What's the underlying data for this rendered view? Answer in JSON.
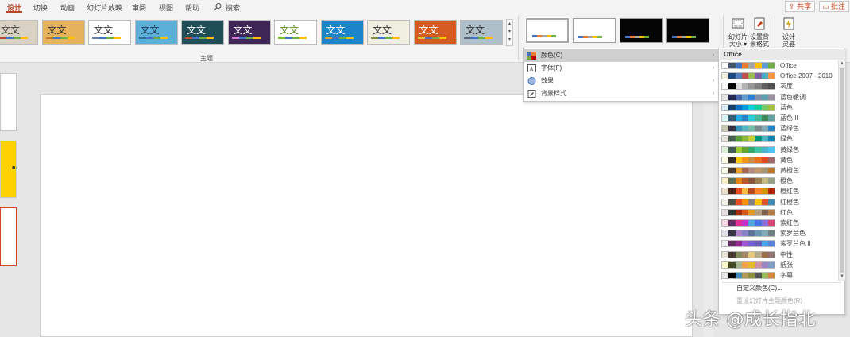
{
  "tabs": [
    {
      "label": "设计",
      "active": true
    },
    {
      "label": "切换",
      "active": false
    },
    {
      "label": "动画",
      "active": false
    },
    {
      "label": "幻灯片放映",
      "active": false
    },
    {
      "label": "审阅",
      "active": false
    },
    {
      "label": "视图",
      "active": false
    },
    {
      "label": "帮助",
      "active": false
    }
  ],
  "search_label": "搜索",
  "share_label": "共享",
  "comments_label": "批注",
  "themes_group_label": "主题",
  "theme_thumbnails": [
    {
      "text": "文文",
      "bg": "#d9d1c4",
      "fg": "#444444",
      "bar": "#b04a3a"
    },
    {
      "text": "文文",
      "bg": "#e7b35a",
      "fg": "#333333",
      "bar": "#c07a2f"
    },
    {
      "text": "文文",
      "bg": "#ffffff",
      "fg": "#333333",
      "bar": "#6b7fa6"
    },
    {
      "text": "文文",
      "bg": "#5ab0d8",
      "fg": "#1f3b57",
      "bar": "#2d6e96"
    },
    {
      "text": "文文",
      "bg": "#1f4e57",
      "fg": "#ffffff",
      "bar": "#d04a3c"
    },
    {
      "text": "文文",
      "bg": "#3e2657",
      "fg": "#ffffff",
      "bar": "#d17ad2"
    },
    {
      "text": "文文",
      "bg": "#ffffff",
      "fg": "#5a8a1f",
      "bar": "#7fbe31"
    },
    {
      "text": "文文",
      "bg": "#1a86c9",
      "fg": "#ffffff",
      "bar": "#e3a32a"
    },
    {
      "text": "文文",
      "bg": "#efeee0",
      "fg": "#333333",
      "bar": "#7e8c48"
    },
    {
      "text": "文文",
      "bg": "#d45a20",
      "fg": "#ffffff",
      "bar": "#f0c040"
    },
    {
      "text": "文文",
      "bg": "#aebfca",
      "fg": "#333333",
      "bar": "#576a7a"
    }
  ],
  "variants": [
    {
      "bg": "#ffffff",
      "selected": true
    },
    {
      "bg": "#ffffff",
      "selected": false
    },
    {
      "bg": "#050505",
      "selected": false
    },
    {
      "bg": "#050505",
      "selected": false
    }
  ],
  "ribbon_buttons": [
    {
      "label": "幻灯片\n大小",
      "icon": "slide-size-icon"
    },
    {
      "label": "设置背\n景格式",
      "icon": "format-background-icon"
    },
    {
      "label": "设计\n灵感",
      "icon": "design-ideas-icon"
    }
  ],
  "menu": {
    "items": [
      {
        "label": "颜色(C)",
        "icon": "colors-icon",
        "highlighted": true
      },
      {
        "label": "字体(F)",
        "icon": "fonts-icon",
        "highlighted": false
      },
      {
        "label": "效果",
        "icon": "effects-icon",
        "highlighted": false
      },
      {
        "label": "背景样式",
        "icon": "background-styles-icon",
        "highlighted": false
      }
    ]
  },
  "colors_submenu": {
    "header": "Office",
    "schemes": [
      {
        "name": "Office",
        "colors": [
          "#ffffff",
          "#44546a",
          "#4472c4",
          "#ed7d31",
          "#a5a5a5",
          "#ffc000",
          "#5b9bd5",
          "#70ad47"
        ]
      },
      {
        "name": "Office 2007 - 2010",
        "colors": [
          "#eeece1",
          "#1f497d",
          "#4f81bd",
          "#c0504d",
          "#9bbb59",
          "#8064a2",
          "#4bacc6",
          "#f79646"
        ]
      },
      {
        "name": "灰度",
        "colors": [
          "#f8f8f8",
          "#000000",
          "#dddddd",
          "#b2b2b2",
          "#969696",
          "#808080",
          "#5f5f5f",
          "#4d4d4d"
        ]
      },
      {
        "name": "蓝色暖调",
        "colors": [
          "#e7e6e6",
          "#242852",
          "#4a66ac",
          "#629dd1",
          "#297fd5",
          "#7f8fa9",
          "#5aa2ae",
          "#9d90a0"
        ]
      },
      {
        "name": "蓝色",
        "colors": [
          "#dbeff9",
          "#17406d",
          "#0f6fc6",
          "#009dd9",
          "#0bd0d9",
          "#10cf9b",
          "#7cca62",
          "#a5c249"
        ]
      },
      {
        "name": "蓝色 II",
        "colors": [
          "#dbf5f9",
          "#335b74",
          "#1cade4",
          "#2683c6",
          "#27ced7",
          "#42ba97",
          "#3e8853",
          "#62a39f"
        ]
      },
      {
        "name": "蓝绿色",
        "colors": [
          "#c8c8b1",
          "#373545",
          "#3494ba",
          "#58b6c0",
          "#75bda7",
          "#7a8c8e",
          "#84acb6",
          "#2683c6"
        ]
      },
      {
        "name": "绿色",
        "colors": [
          "#e9e5dc",
          "#455f51",
          "#549e39",
          "#8ab833",
          "#c0cf3a",
          "#029676",
          "#4ab5c4",
          "#0989b1"
        ]
      },
      {
        "name": "黄绿色",
        "colors": [
          "#dbefd7",
          "#455f51",
          "#99cb38",
          "#63a537",
          "#37a76f",
          "#44c1a3",
          "#4eb3cf",
          "#51c3f9"
        ]
      },
      {
        "name": "黄色",
        "colors": [
          "#fffde6",
          "#39302a",
          "#ffca08",
          "#f8931d",
          "#ce8d3e",
          "#ec7016",
          "#e64823",
          "#9c6a6a"
        ]
      },
      {
        "name": "黄橙色",
        "colors": [
          "#fcf8e8",
          "#4e3b30",
          "#f0a22e",
          "#a5644e",
          "#b58b80",
          "#c3986d",
          "#a19574",
          "#c17529"
        ]
      },
      {
        "name": "橙色",
        "colors": [
          "#fbeec9",
          "#637052",
          "#e48312",
          "#bd582c",
          "#865640",
          "#9b8357",
          "#c2bc80",
          "#94a088"
        ]
      },
      {
        "name": "橙红色",
        "colors": [
          "#e7dec9",
          "#4f271c",
          "#e84c22",
          "#ffbd47",
          "#b64926",
          "#ff8427",
          "#cc9900",
          "#b22600"
        ]
      },
      {
        "name": "红橙色",
        "colors": [
          "#f2efe5",
          "#505046",
          "#e84c22",
          "#f69200",
          "#838383",
          "#fec306",
          "#df5327",
          "#418ab3"
        ]
      },
      {
        "name": "红色",
        "colors": [
          "#e7dfe0",
          "#323232",
          "#a5300f",
          "#d55816",
          "#e19825",
          "#b19c7d",
          "#7f5f52",
          "#b27d49"
        ]
      },
      {
        "name": "紫红色",
        "colors": [
          "#f6d4e2",
          "#632e62",
          "#e32d91",
          "#c830cc",
          "#4ea6dc",
          "#4775e7",
          "#8971e1",
          "#d54773"
        ]
      },
      {
        "name": "紫罗兰色",
        "colors": [
          "#e3e0ea",
          "#373545",
          "#ad84c6",
          "#8784c7",
          "#5d739a",
          "#6997af",
          "#84acb6",
          "#6f8183"
        ]
      },
      {
        "name": "紫罗兰色 II",
        "colors": [
          "#f0eef3",
          "#632e62",
          "#92278f",
          "#9b57d3",
          "#755dd9",
          "#665eb8",
          "#45a5ed",
          "#5982db"
        ]
      },
      {
        "name": "中性",
        "colors": [
          "#e8e2d7",
          "#4a3c31",
          "#7f8b5b",
          "#a08661",
          "#e6c77e",
          "#b6a98c",
          "#9b6e4b",
          "#90746d"
        ]
      },
      {
        "name": "纸张",
        "colors": [
          "#fefac9",
          "#444d26",
          "#a5b592",
          "#f3a447",
          "#e7bc29",
          "#d092a7",
          "#9c85c0",
          "#809ec2"
        ]
      },
      {
        "name": "字幕",
        "colors": [
          "#e8e8e8",
          "#000000",
          "#418ab3",
          "#ae9a55",
          "#8d8f38",
          "#555555",
          "#9bbb59",
          "#d4843b"
        ]
      }
    ],
    "customize_label": "自定义颜色(C)...",
    "reset_label": "重设幻灯片主题颜色(R)"
  },
  "watermark": "头条 @成长指北"
}
